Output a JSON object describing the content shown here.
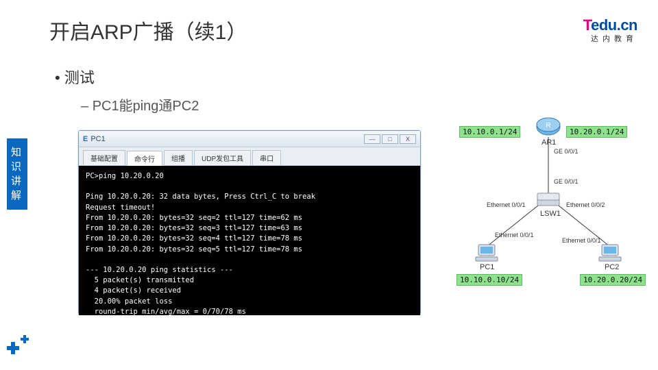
{
  "title": "开启ARP广播（续1）",
  "logo": {
    "t": "T",
    "edu": "edu.",
    "cn": "cn",
    "sub": "达内教育"
  },
  "bullets": {
    "b1": "测试",
    "b2": "PC1能ping通PC2"
  },
  "side_tab": "知识讲解",
  "window": {
    "title": "PC1",
    "btn_min": "—",
    "btn_max": "□",
    "btn_close": "X",
    "tabs": [
      "基础配置",
      "命令行",
      "组播",
      "UDP发包工具",
      "串口"
    ],
    "active_tab_index": 1,
    "terminal_lines": [
      "PC>ping 10.20.0.20",
      "",
      "Ping 10.20.0.20: 32 data bytes, Press Ctrl_C to break",
      "Request timeout!",
      "From 10.20.0.20: bytes=32 seq=2 ttl=127 time=62 ms",
      "From 10.20.0.20: bytes=32 seq=3 ttl=127 time=63 ms",
      "From 10.20.0.20: bytes=32 seq=4 ttl=127 time=78 ms",
      "From 10.20.0.20: bytes=32 seq=5 ttl=127 time=78 ms",
      "",
      "--- 10.20.0.20 ping statistics ---",
      "  5 packet(s) transmitted",
      "  4 packet(s) received",
      "  20.00% packet loss",
      "  round-trip min/avg/max = 0/70/78 ms",
      ""
    ]
  },
  "diagram": {
    "ar1": {
      "name": "AR1",
      "ip_left": "10.10.0.1/24",
      "ip_right": "10.20.0.1/24",
      "port": "GE 0/0/1"
    },
    "lsw1": {
      "name": "LSW1",
      "port_up": "GE 0/0/1",
      "port_left": "Ethernet 0/0/1",
      "port_right": "Ethernet 0/0/2"
    },
    "pc1": {
      "name": "PC1",
      "ip": "10.10.0.10/24",
      "port": "Ethernet 0/0/1"
    },
    "pc2": {
      "name": "PC2",
      "ip": "10.20.0.20/24",
      "port": "Ethernet 0/0/1"
    }
  }
}
